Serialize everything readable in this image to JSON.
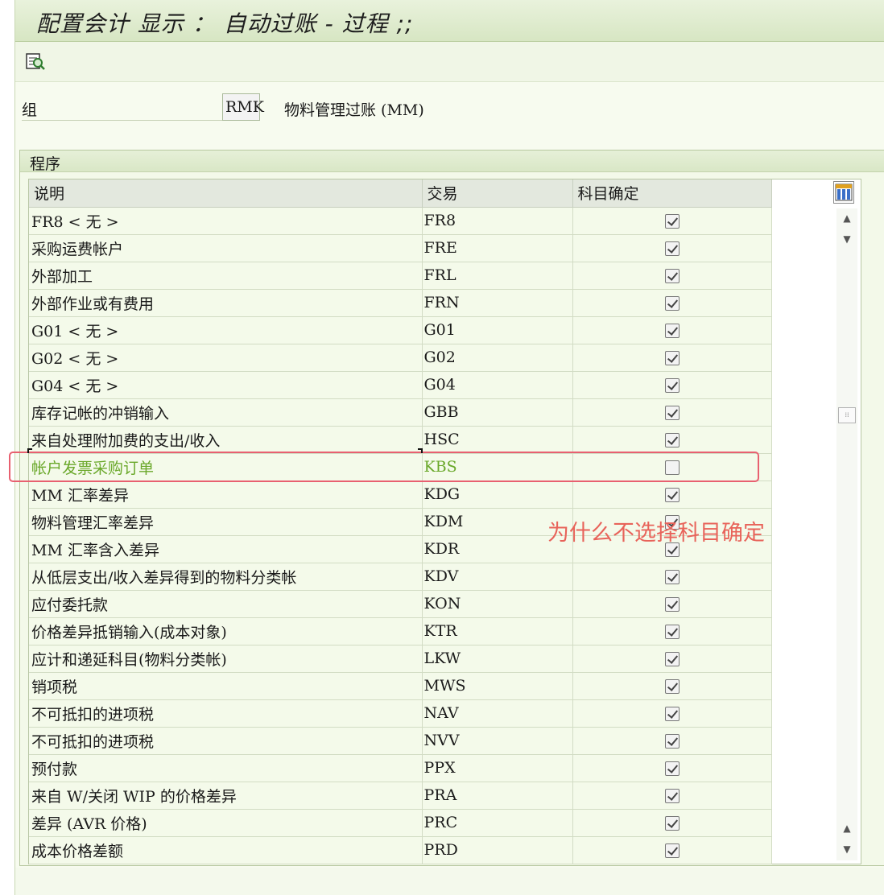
{
  "window": {
    "title": "配置会计 显示 ： 自动过账 - 过程 ;;"
  },
  "toolbar": {
    "buttons": [
      {
        "icon": "display-detail-icon"
      }
    ]
  },
  "header": {
    "group_label": "组",
    "group_value": "RMK",
    "group_description": "物料管理过账 (MM)"
  },
  "program_box": {
    "title": "程序",
    "columns": [
      "说明",
      "交易",
      "科目确定"
    ],
    "rows": [
      {
        "desc": "FR8 < 无 >",
        "tx": "FR8",
        "checked": true
      },
      {
        "desc": "采购运费帐户",
        "tx": "FRE",
        "checked": true
      },
      {
        "desc": "外部加工",
        "tx": "FRL",
        "checked": true
      },
      {
        "desc": "外部作业或有费用",
        "tx": "FRN",
        "checked": true
      },
      {
        "desc": "G01 < 无 >",
        "tx": "G01",
        "checked": true
      },
      {
        "desc": "G02 < 无 >",
        "tx": "G02",
        "checked": true
      },
      {
        "desc": "G04 < 无 >",
        "tx": "G04",
        "checked": true
      },
      {
        "desc": "库存记帐的冲销输入",
        "tx": "GBB",
        "checked": true
      },
      {
        "desc": "来自处理附加费的支出/收入",
        "tx": "HSC",
        "checked": true
      },
      {
        "desc": "帐户发票采购订单",
        "tx": "KBS",
        "checked": false,
        "highlight": true
      },
      {
        "desc": "MM 汇率差异",
        "tx": "KDG",
        "checked": true
      },
      {
        "desc": "物料管理汇率差异",
        "tx": "KDM",
        "checked": true
      },
      {
        "desc": "MM 汇率含入差异",
        "tx": "KDR",
        "checked": true
      },
      {
        "desc": "从低层支出/收入差异得到的物料分类帐",
        "tx": "KDV",
        "checked": true
      },
      {
        "desc": "应付委托款",
        "tx": "KON",
        "checked": true
      },
      {
        "desc": "价格差异抵销输入(成本对象)",
        "tx": "KTR",
        "checked": true
      },
      {
        "desc": "应计和递延科目(物料分类帐)",
        "tx": "LKW",
        "checked": true
      },
      {
        "desc": "销项税",
        "tx": "MWS",
        "checked": true
      },
      {
        "desc": "不可抵扣的进项税",
        "tx": "NAV",
        "checked": true
      },
      {
        "desc": "不可抵扣的进项税",
        "tx": "NVV",
        "checked": true
      },
      {
        "desc": "预付款",
        "tx": "PPX",
        "checked": true
      },
      {
        "desc": "来自 W/关闭 WIP 的价格差异",
        "tx": "PRA",
        "checked": true
      },
      {
        "desc": "差异 (AVR 价格)",
        "tx": "PRC",
        "checked": true
      },
      {
        "desc": "成本价格差额",
        "tx": "PRD",
        "checked": true
      }
    ]
  },
  "annotation": {
    "text": "为什么不选择科目确定",
    "color": "#e8635a"
  },
  "colors": {
    "highlight_text": "#6aa82a",
    "highlight_border": "#e86070"
  }
}
